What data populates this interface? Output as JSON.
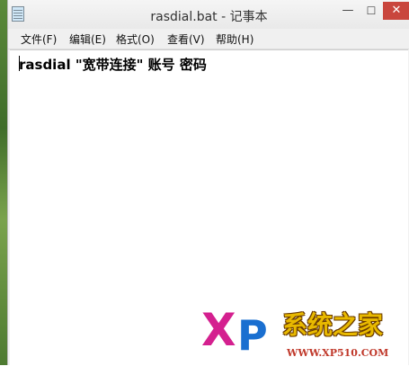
{
  "window": {
    "title": "rasdial.bat - 记事本",
    "buttons": {
      "minimize": "—",
      "maximize": "☐",
      "close": "✕"
    }
  },
  "menu": [
    {
      "label": "文件(F)"
    },
    {
      "label": "编辑(E)"
    },
    {
      "label": "格式(O)"
    },
    {
      "label": "查看(V)"
    },
    {
      "label": "帮助(H)"
    }
  ],
  "editor": {
    "content": "rasdial \"宽带连接\" 账号 密码"
  },
  "watermark": {
    "logo_letters": "XP",
    "site_name": "系统之家",
    "url": "WWW.XP510.COM"
  }
}
